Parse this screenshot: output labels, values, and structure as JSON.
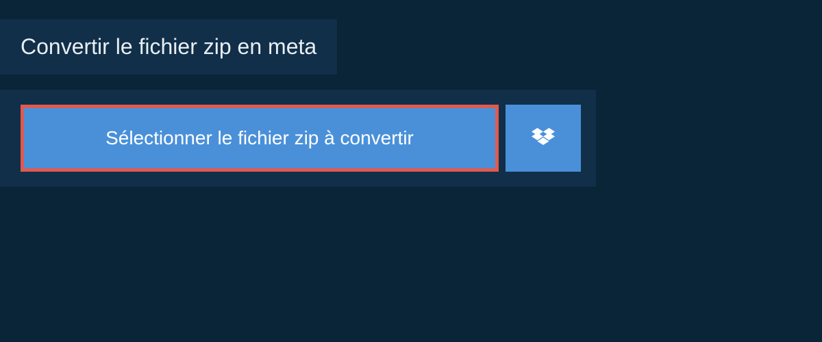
{
  "header": {
    "title": "Convertir le fichier zip en meta"
  },
  "actions": {
    "select_label": "Sélectionner le fichier zip à convertir"
  },
  "colors": {
    "background": "#0a2438",
    "panel": "#112f48",
    "button": "#4a90d9",
    "highlight_border": "#e05a50",
    "text_light": "#e8eef3"
  }
}
